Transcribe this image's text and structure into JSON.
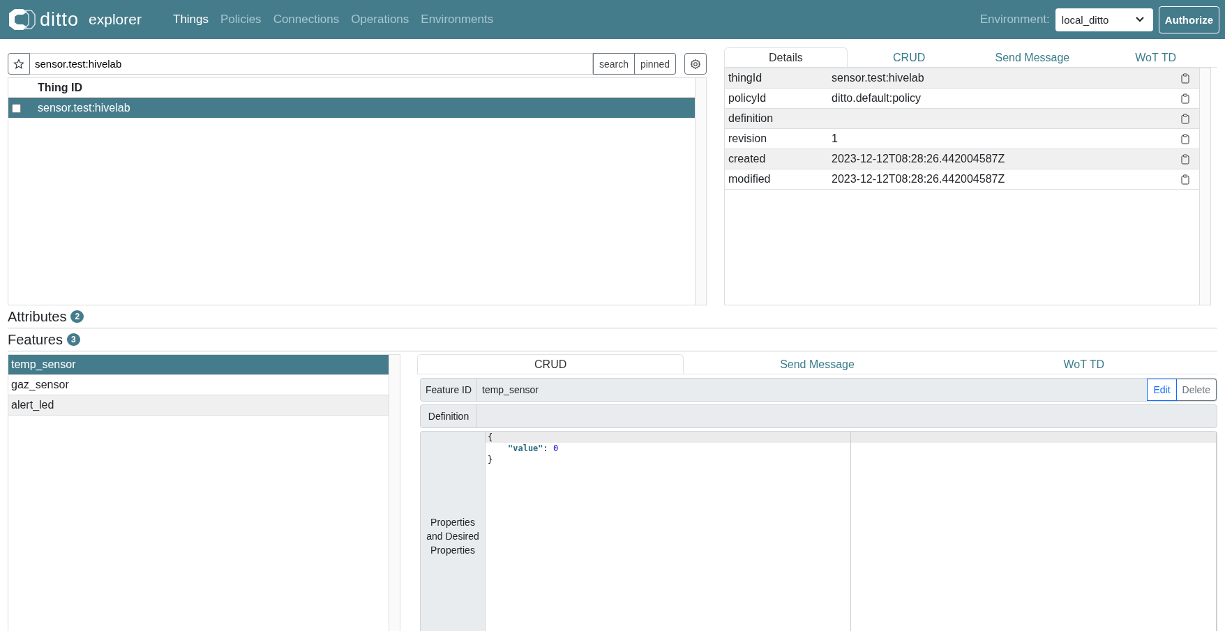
{
  "header": {
    "logo_text": "ditto",
    "app_name": "explorer",
    "nav": [
      {
        "label": "Things",
        "selected": true
      },
      {
        "label": "Policies",
        "selected": false
      },
      {
        "label": "Connections",
        "selected": false
      },
      {
        "label": "Operations",
        "selected": false
      },
      {
        "label": "Environments",
        "selected": false
      }
    ],
    "environment_label": "Environment:",
    "environment": "local_ditto",
    "authorize": "Authorize"
  },
  "search": {
    "value": "sensor.test:hivelab",
    "buttons": [
      "search",
      "pinned"
    ]
  },
  "things_table": {
    "columns": [
      "Thing ID"
    ],
    "rows": [
      {
        "thing_id": "sensor.test:hivelab",
        "selected": true,
        "checked": false
      }
    ]
  },
  "thing_tabs": [
    {
      "label": "Details",
      "selected": true
    },
    {
      "label": "CRUD",
      "selected": false
    },
    {
      "label": "Send Message",
      "selected": false
    },
    {
      "label": "WoT TD",
      "selected": false
    }
  ],
  "details": [
    {
      "key": "thingId",
      "value": "sensor.test:hivelab"
    },
    {
      "key": "policyId",
      "value": "ditto.default:policy"
    },
    {
      "key": "definition"
    },
    {
      "key": "revision",
      "value": "1"
    },
    {
      "key": "created",
      "value": "2023-12-12T08:28:26.442004587Z"
    },
    {
      "key": "modified",
      "value": "2023-12-12T08:28:26.442004587Z"
    }
  ],
  "attributes": {
    "title": "Attributes",
    "count": "2"
  },
  "features": {
    "title": "Features",
    "count": "3",
    "items": [
      {
        "label": "temp_sensor",
        "selected": true
      },
      {
        "label": "gaz_sensor",
        "selected": false
      },
      {
        "label": "alert_led",
        "selected": false
      }
    ]
  },
  "feature_tabs": [
    {
      "label": "CRUD",
      "selected": true
    },
    {
      "label": "Send Message",
      "selected": false
    },
    {
      "label": "WoT TD",
      "selected": false
    }
  ],
  "feature": {
    "id_label": "Feature ID",
    "id": "temp_sensor",
    "edit": "Edit",
    "delete": "Delete",
    "definition_label": "Definition",
    "properties_label": "Properties and Desired Properties",
    "code_lines": [
      {
        "indented": false,
        "tokens": [
          {
            "kind": "punct",
            "text": "{"
          }
        ]
      },
      {
        "indented": true,
        "tokens": [
          {
            "kind": "key",
            "text": "\"value\""
          },
          {
            "kind": "punct",
            "text": ": "
          },
          {
            "kind": "number",
            "text": "0"
          }
        ]
      },
      {
        "indented": false,
        "tokens": [
          {
            "kind": "punct",
            "text": "}"
          }
        ]
      }
    ]
  }
}
